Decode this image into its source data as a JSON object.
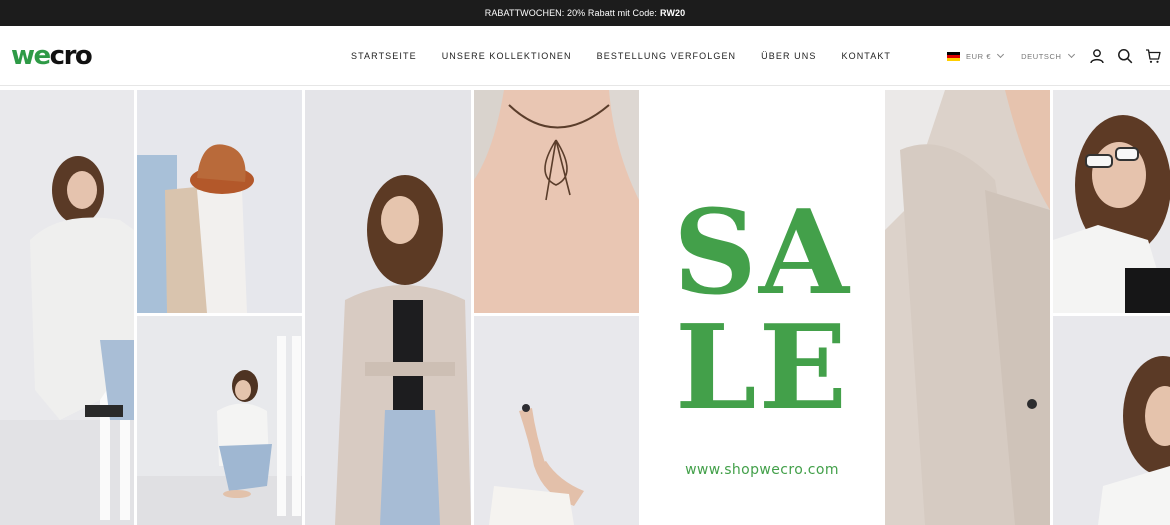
{
  "announcement": {
    "text": "RABATTWOCHEN: 20% Rabatt mit Code:",
    "code": "RW20"
  },
  "logo": {
    "part1": "we",
    "part2": "cro"
  },
  "nav": {
    "home": "STARTSEITE",
    "collections": "UNSERE KOLLEKTIONEN",
    "track_order": "BESTELLUNG VERFOLGEN",
    "about": "ÜBER UNS",
    "contact": "KONTAKT"
  },
  "locale": {
    "currency": "EUR €",
    "language": "DEUTSCH"
  },
  "header_icons": [
    "account-icon",
    "search-icon",
    "cart-icon"
  ],
  "hero": {
    "sale_line1": "SA",
    "sale_line2": "LE",
    "url": "www.shopwecro.com",
    "accent_color": "#43a04a"
  }
}
